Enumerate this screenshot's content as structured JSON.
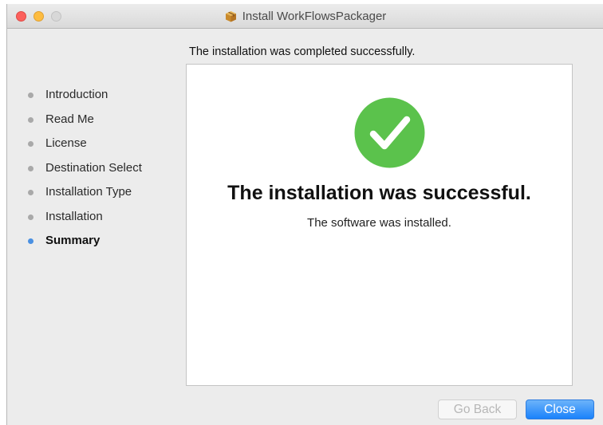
{
  "window": {
    "title": "Install WorkFlowsPackager",
    "title_icon": "package-icon"
  },
  "header": {
    "subtitle": "The installation was completed successfully."
  },
  "sidebar": {
    "items": [
      {
        "label": "Introduction",
        "active": false
      },
      {
        "label": "Read Me",
        "active": false
      },
      {
        "label": "License",
        "active": false
      },
      {
        "label": "Destination Select",
        "active": false
      },
      {
        "label": "Installation Type",
        "active": false
      },
      {
        "label": "Installation",
        "active": false
      },
      {
        "label": "Summary",
        "active": true
      }
    ]
  },
  "main": {
    "status_icon": "success-check-icon",
    "headline": "The installation was successful.",
    "message": "The software was installed."
  },
  "buttons": {
    "back_label": "Go Back",
    "close_label": "Close"
  },
  "colors": {
    "success_green": "#5bc24c",
    "accent_blue": "#1a82fb",
    "active_dot": "#4a90e2"
  }
}
